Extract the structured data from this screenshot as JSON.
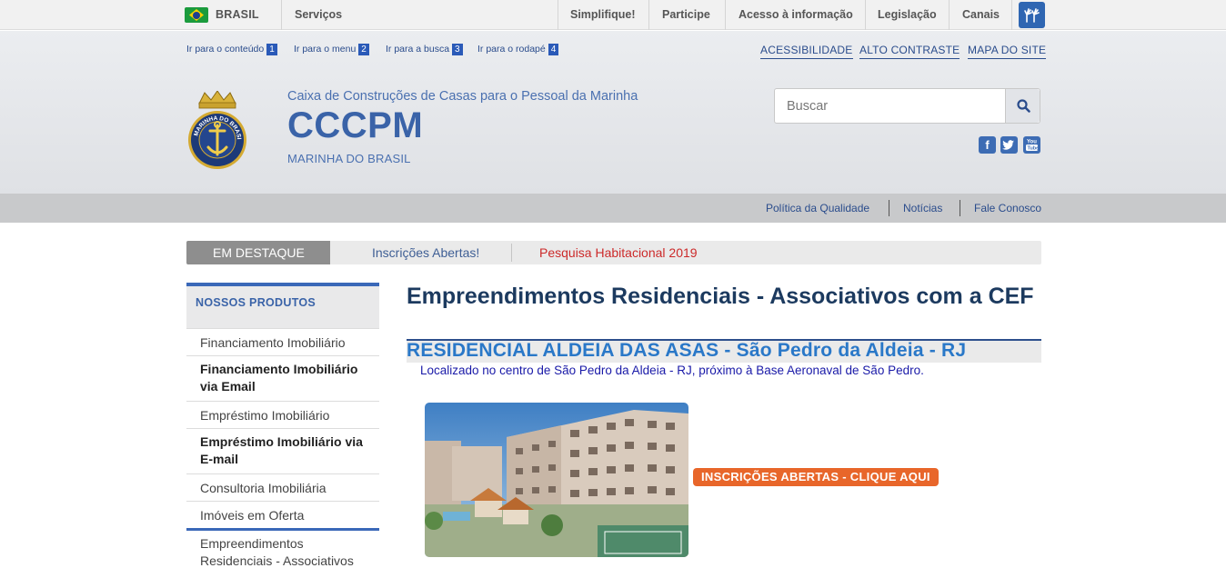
{
  "gov_bar": {
    "country": "BRASIL",
    "servicos": "Serviços",
    "links": [
      "Simplifique!",
      "Participe",
      "Acesso à informação",
      "Legislação",
      "Canais"
    ]
  },
  "skip_links": [
    {
      "label": "Ir para o conteúdo",
      "num": "1"
    },
    {
      "label": "Ir para o menu",
      "num": "2"
    },
    {
      "label": "Ir para a busca",
      "num": "3"
    },
    {
      "label": "Ir para o rodapé",
      "num": "4"
    }
  ],
  "accessibility": [
    "ACESSIBILIDADE",
    "ALTO CONTRASTE",
    "MAPA DO SITE"
  ],
  "site": {
    "subtitle": "Caixa de Construções de Casas para o Pessoal da Marinha",
    "title": "CCCPM",
    "org": "MARINHA DO BRASIL",
    "logo_text": "MARINHA DO BRASIL"
  },
  "search": {
    "placeholder": "Buscar"
  },
  "social": [
    "facebook-icon",
    "twitter-icon",
    "youtube-icon"
  ],
  "service_links": [
    "Política da Qualidade",
    "Notícias",
    "Fale Conosco"
  ],
  "destaque": {
    "label": "EM DESTAQUE",
    "item1": "Inscrições Abertas!",
    "item2": "Pesquisa Habitacional 2019"
  },
  "sidebar": {
    "heading": "NOSSOS PRODUTOS",
    "items": [
      "Financiamento Imobiliário",
      "Financiamento Imobiliário via Email",
      "Empréstimo Imobiliário",
      "Empréstimo Imobiliário via E-mail",
      "Consultoria Imobiliária",
      "Imóveis em Oferta",
      "Empreendimentos Residenciais - Associativos"
    ]
  },
  "main": {
    "heading": "Empreendimentos Residenciais - Associativos com a CEF",
    "residential_title": "RESIDENCIAL ALDEIA DAS ASAS - São Pedro da Aldeia - RJ",
    "residential_desc": "Localizado no centro de São Pedro da Aldeia - RJ, próximo à Base Aeronaval de São Pedro.",
    "badge": "INSCRIÇÕES ABERTAS - CLIQUE AQUI"
  },
  "colors": {
    "brand_blue": "#3a63a8",
    "accent_orange": "#e8662a",
    "highlight_red": "#cc2a2a"
  }
}
